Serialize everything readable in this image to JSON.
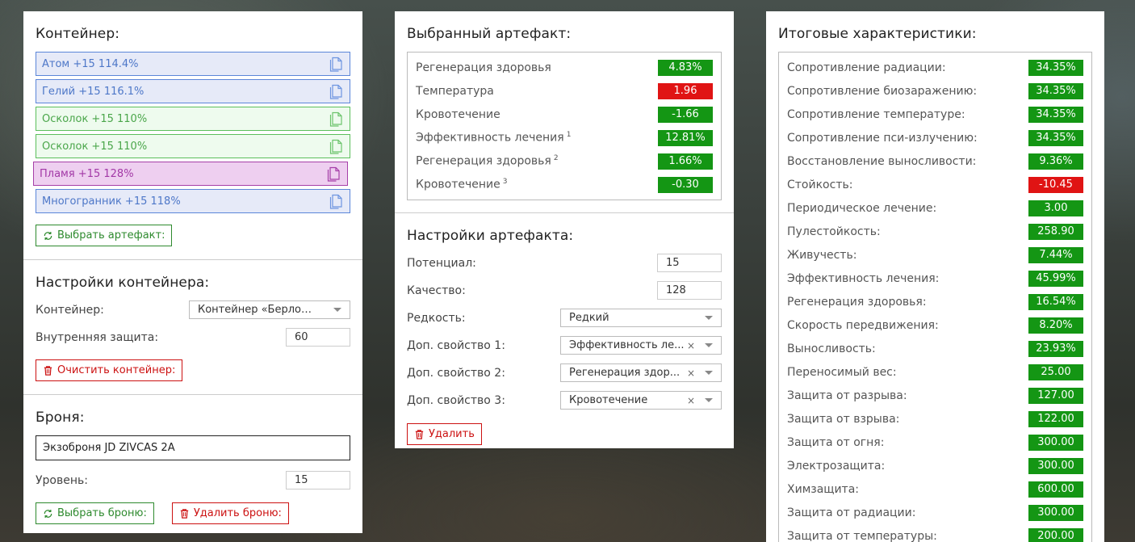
{
  "container": {
    "title": "Контейнер:",
    "slots": [
      {
        "label": "Атом +15 114.4%",
        "color": "blue"
      },
      {
        "label": "Гелий +15 116.1%",
        "color": "blue"
      },
      {
        "label": "Осколок +15 110%",
        "color": "green"
      },
      {
        "label": "Осколок +15 110%",
        "color": "green"
      },
      {
        "label": "Пламя +15 128%",
        "color": "pink"
      },
      {
        "label": "Многогранник +15 118%",
        "color": "blue"
      }
    ],
    "select_button": "Выбрать артефакт:"
  },
  "container_settings": {
    "title": "Настройки контейнера:",
    "container_label": "Контейнер:",
    "container_value": "Контейнер «Берлога...",
    "protection_label": "Внутренняя защита:",
    "protection_value": "60",
    "clear_button": "Очистить контейнер:"
  },
  "armor": {
    "title": "Броня:",
    "name": "Экзоброня JD ZIVCAS 2A",
    "level_label": "Уровень:",
    "level_value": "15",
    "select_button": "Выбрать броню:",
    "delete_button": "Удалить броню:"
  },
  "selected_artifact": {
    "title": "Выбранный артефакт:",
    "stats": [
      {
        "label": "Регенерация здоровья",
        "sup": "",
        "value": "4.83%",
        "tone": "pos"
      },
      {
        "label": "Температура",
        "sup": "",
        "value": "1.96",
        "tone": "neg"
      },
      {
        "label": "Кровотечение",
        "sup": "",
        "value": "-1.66",
        "tone": "pos"
      },
      {
        "label": "Эффективность лечения",
        "sup": "1",
        "value": "12.81%",
        "tone": "pos"
      },
      {
        "label": "Регенерация здоровья",
        "sup": "2",
        "value": "1.66%",
        "tone": "pos"
      },
      {
        "label": "Кровотечение",
        "sup": "3",
        "value": "-0.30",
        "tone": "pos"
      }
    ]
  },
  "artifact_settings": {
    "title": "Настройки артефакта:",
    "potential_label": "Потенциал:",
    "potential_value": "15",
    "quality_label": "Качество:",
    "quality_value": "128",
    "rarity_label": "Редкость:",
    "rarity_value": "Редкий",
    "extra1_label": "Доп. свойство 1:",
    "extra1_value": "Эффективность ле...",
    "extra2_label": "Доп. свойство 2:",
    "extra2_value": "Регенерация здор...",
    "extra3_label": "Доп. свойство 3:",
    "extra3_value": "Кровотечение",
    "clear_symbol": "×",
    "delete_button": "Удалить"
  },
  "totals": {
    "title": "Итоговые характеристики:",
    "stats": [
      {
        "label": "Сопротивление радиации:",
        "value": "34.35%",
        "tone": "pos"
      },
      {
        "label": "Сопротивление биозаражению:",
        "value": "34.35%",
        "tone": "pos"
      },
      {
        "label": "Сопротивление температуре:",
        "value": "34.35%",
        "tone": "pos"
      },
      {
        "label": "Сопротивление пси-излучению:",
        "value": "34.35%",
        "tone": "pos"
      },
      {
        "label": "Восстановление выносливости:",
        "value": "9.36%",
        "tone": "pos"
      },
      {
        "label": "Стойкость:",
        "value": "-10.45",
        "tone": "neg"
      },
      {
        "label": "Периодическое лечение:",
        "value": "3.00",
        "tone": "pos"
      },
      {
        "label": "Пулестойкость:",
        "value": "258.90",
        "tone": "pos"
      },
      {
        "label": "Живучесть:",
        "value": "7.44%",
        "tone": "pos"
      },
      {
        "label": "Эффективность лечения:",
        "value": "45.99%",
        "tone": "pos"
      },
      {
        "label": "Регенерация здоровья:",
        "value": "16.54%",
        "tone": "pos"
      },
      {
        "label": "Скорость передвижения:",
        "value": "8.20%",
        "tone": "pos"
      },
      {
        "label": "Выносливость:",
        "value": "23.93%",
        "tone": "pos"
      },
      {
        "label": "Переносимый вес:",
        "value": "25.00",
        "tone": "pos"
      },
      {
        "label": "Защита от разрыва:",
        "value": "127.00",
        "tone": "pos"
      },
      {
        "label": "Защита от взрыва:",
        "value": "122.00",
        "tone": "pos"
      },
      {
        "label": "Защита от огня:",
        "value": "300.00",
        "tone": "pos"
      },
      {
        "label": "Электрозащита:",
        "value": "300.00",
        "tone": "pos"
      },
      {
        "label": "Химзащита:",
        "value": "600.00",
        "tone": "pos"
      },
      {
        "label": "Защита от радиации:",
        "value": "300.00",
        "tone": "pos"
      },
      {
        "label": "Защита от температуры:",
        "value": "200.00",
        "tone": "pos"
      }
    ]
  }
}
